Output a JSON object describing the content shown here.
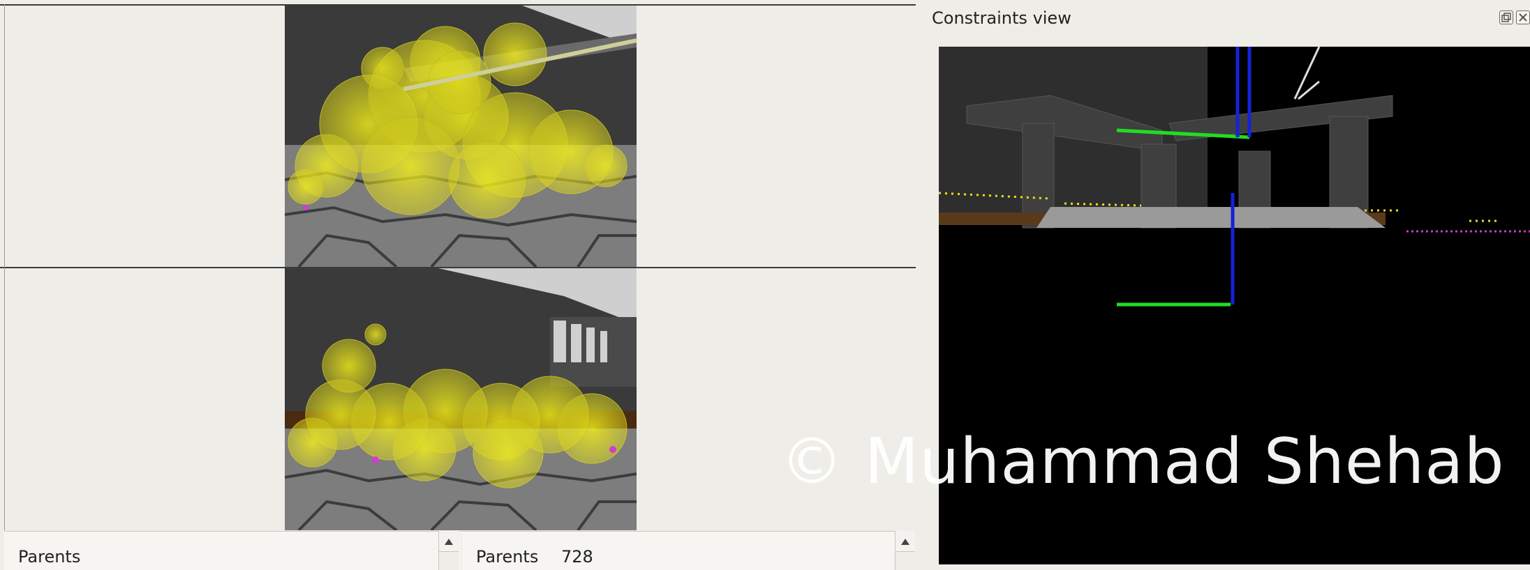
{
  "constraints_view": {
    "title": "Constraints view",
    "float_button_icon": "float-icon",
    "close_button_icon": "close-icon"
  },
  "left_panel": {
    "list_header": "Parents"
  },
  "middle_panel": {
    "list_header": "Parents",
    "count": "728"
  },
  "watermark": "© Muhammad Shehab",
  "colors": {
    "window_bg": "#efede8",
    "particle_yellow": "#f2ee1e",
    "constraint_green": "#22dd22",
    "constraint_blue": "#1522d8"
  }
}
